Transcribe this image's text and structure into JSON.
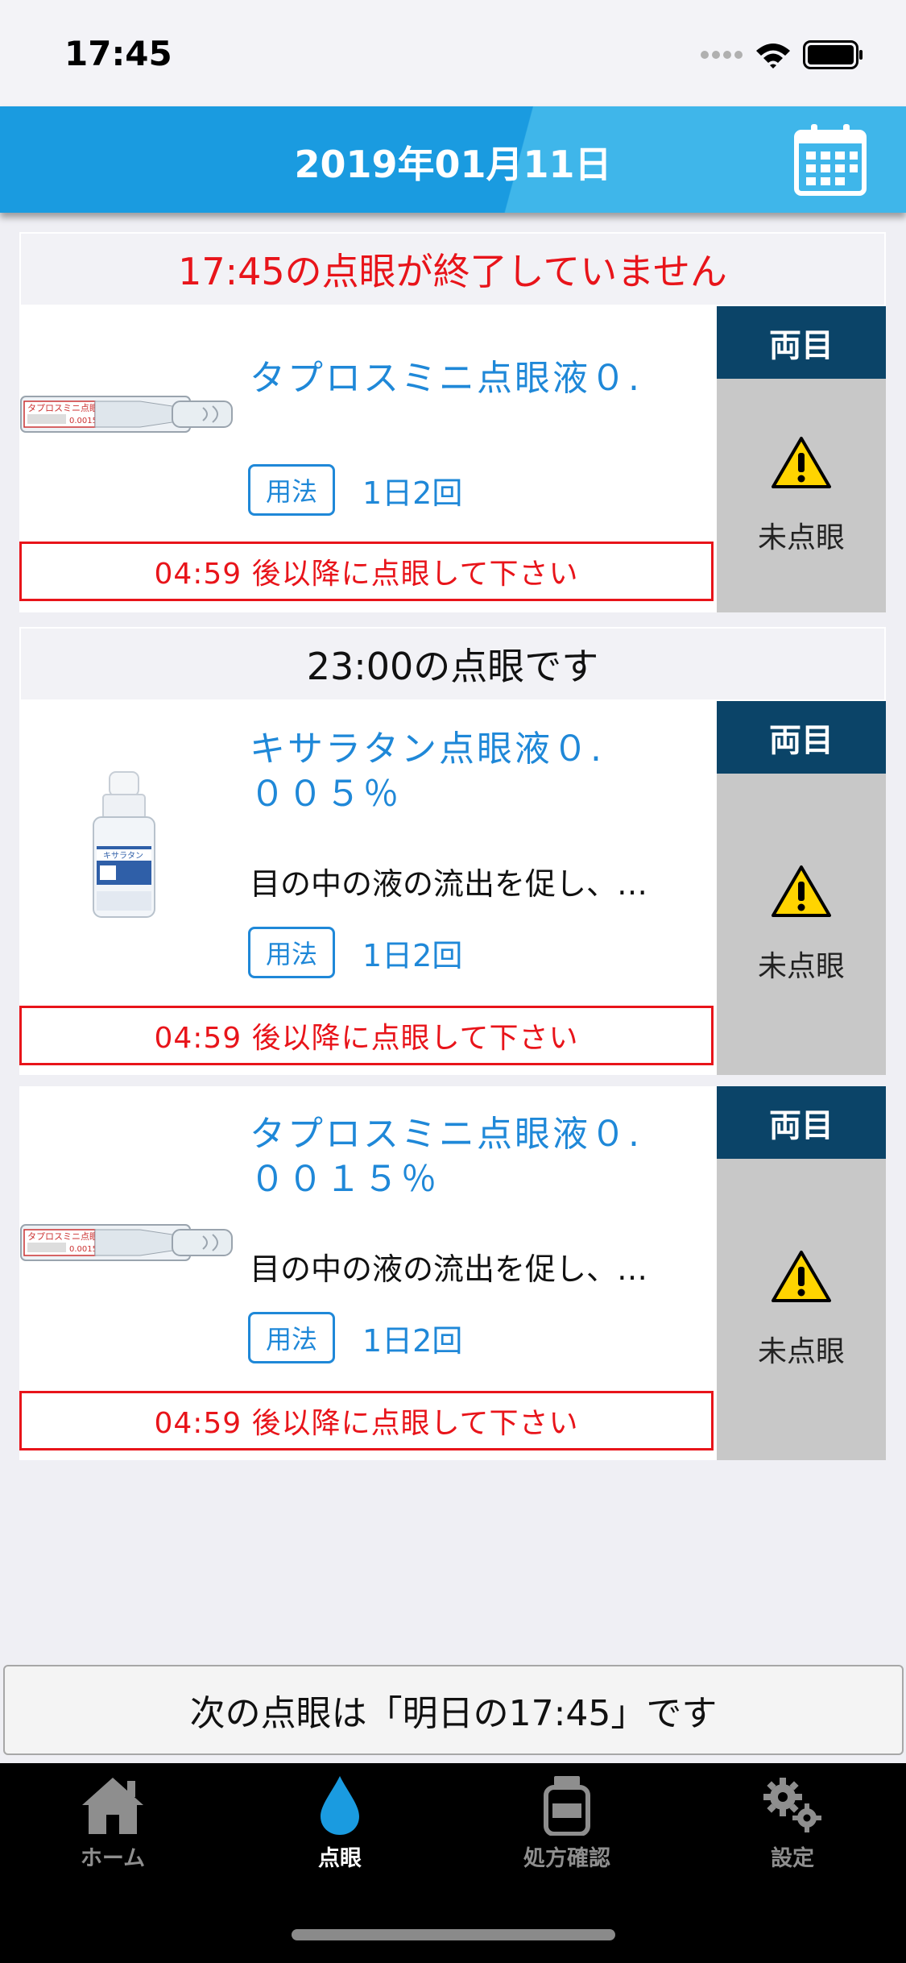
{
  "status_bar": {
    "time": "17:45"
  },
  "header": {
    "title": "2019年01月11日"
  },
  "sections": [
    {
      "header": "17:45の点眼が終了していません",
      "items": [
        {
          "name": "タプロスミニ点眼液０.",
          "description": "",
          "usage_badge": "用法",
          "frequency": "1日2回",
          "notice": "04:59 後以降に点眼して下さい",
          "eye": "両目",
          "status": "未点眼"
        }
      ]
    },
    {
      "header": "23:00の点眼です",
      "items": [
        {
          "name": "キサラタン点眼液０.\n００５％",
          "description": "目の中の液の流出を促し、…",
          "usage_badge": "用法",
          "frequency": "1日2回",
          "notice": "04:59 後以降に点眼して下さい",
          "eye": "両目",
          "status": "未点眼"
        },
        {
          "name": "タプロスミニ点眼液０.\n００１５％",
          "description": "目の中の液の流出を促し、…",
          "usage_badge": "用法",
          "frequency": "1日2回",
          "notice": "04:59 後以降に点眼して下さい",
          "eye": "両目",
          "status": "未点眼"
        }
      ]
    }
  ],
  "next_dose": "次の点眼は「明日の17:45」です",
  "product_labels": {
    "taplos_label": "タプロスミニ点眼液",
    "taplos_strength": "0.0015%",
    "xalatan_label": "キサラタン"
  },
  "tabs": [
    {
      "label": "ホーム",
      "icon": "home-icon",
      "active": false
    },
    {
      "label": "点眼",
      "icon": "drop-icon",
      "active": true
    },
    {
      "label": "処方確認",
      "icon": "bottle-icon",
      "active": false
    },
    {
      "label": "設定",
      "icon": "gear-icon",
      "active": false
    }
  ],
  "colors": {
    "accent": "#1f88d8",
    "alert": "#e8141a",
    "eye_label_bg": "#0b4468",
    "nav_bar": "#1a9be0"
  }
}
